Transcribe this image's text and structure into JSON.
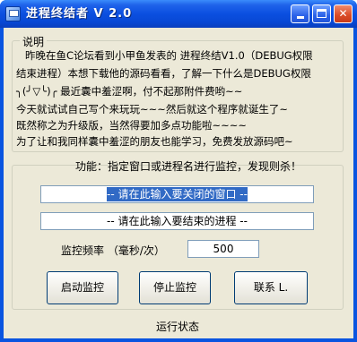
{
  "window": {
    "title": "进程终结者 V 2.0"
  },
  "notes": {
    "legend": "说明",
    "lines": [
      "昨晚在鱼C论坛看到小甲鱼发表的 进程终结V1.0（DEBUG权限",
      "结束进程）本想下载他的源码看看，了解一下什么是DEBUG权限",
      "╮(╯▽╰)╭   最近囊中羞涩啊，付不起那附件费哟~~",
      "今天就试试自己写个来玩玩~~~然后就这个程序就诞生了~",
      "既然称之为升级版，当然得要加多点功能啦~~~~",
      "为了让和我同样囊中羞涩的朋友也能学习，免费发放源码吧~"
    ]
  },
  "controls": {
    "feature_text": "功能：指定窗口或进程名进行监控，发现则杀！",
    "window_input_value": "-- 请在此输入要关闭的窗口 --",
    "process_input_value": "-- 请在此输入要结束的进程 --",
    "frequency_label": "监控频率 （毫秒/次）",
    "frequency_value": "500"
  },
  "buttons": {
    "start": "启动监控",
    "stop": "停止监控",
    "contact": "联系  L."
  },
  "status_text": "运行状态"
}
